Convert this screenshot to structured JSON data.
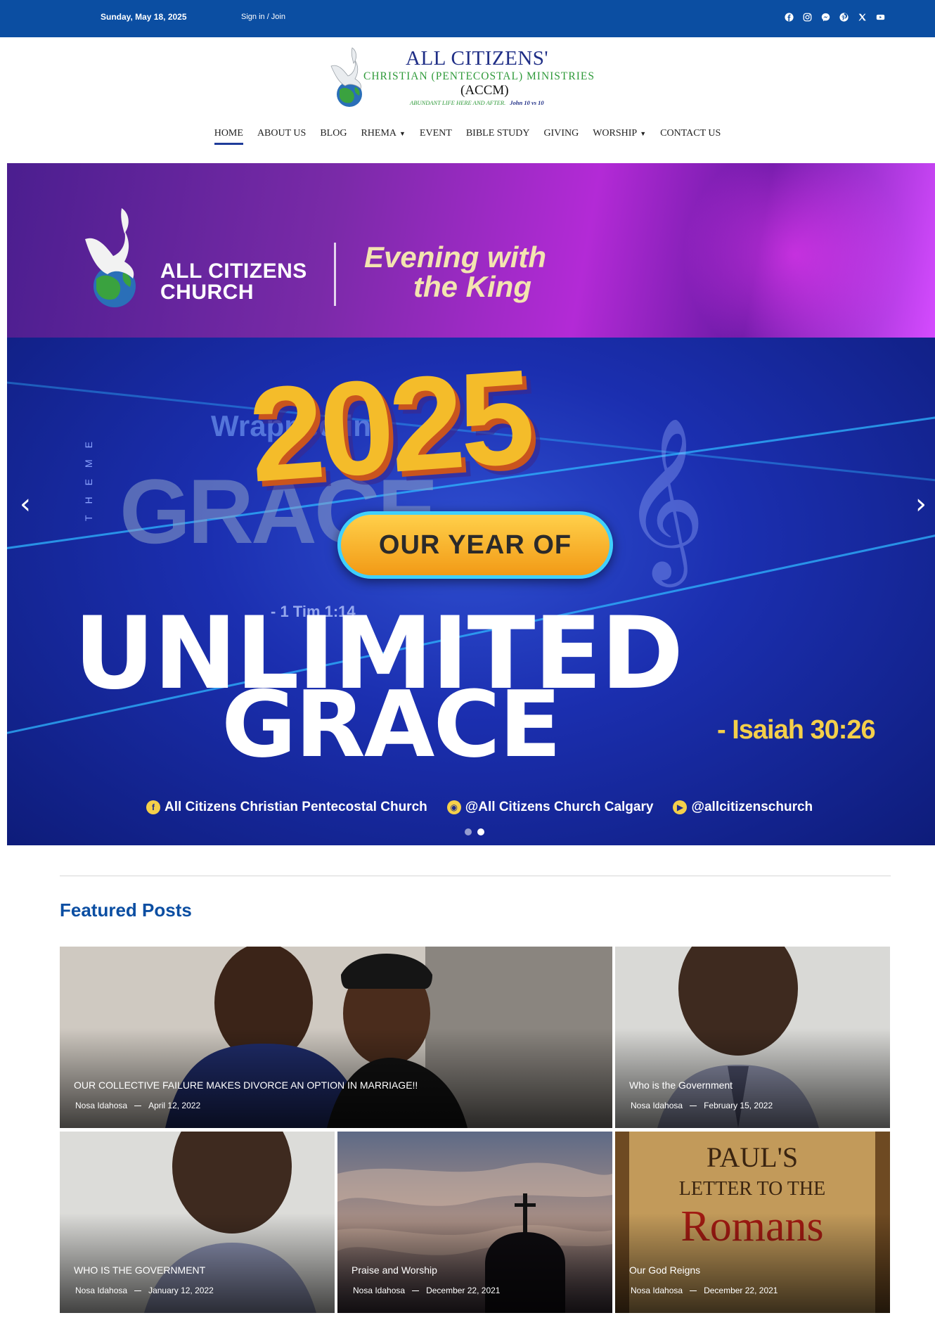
{
  "topbar": {
    "date": "Sunday, May 18, 2025",
    "signin": "Sign in / Join",
    "social": [
      "facebook-icon",
      "instagram-icon",
      "messenger-icon",
      "pinterest-icon",
      "x-icon",
      "youtube-icon"
    ]
  },
  "logo": {
    "line1": "ALL CITIZENS'",
    "line2": "CHRISTIAN (PENTECOSTAL) MINISTRIES",
    "line3": "(ACCM)",
    "tagline": "ABUNDANT LIFE HERE AND AFTER.",
    "verse": "John 10 vs 10"
  },
  "nav": [
    {
      "label": "HOME",
      "dropdown": false,
      "active": true
    },
    {
      "label": "ABOUT US",
      "dropdown": false
    },
    {
      "label": "BLOG",
      "dropdown": false
    },
    {
      "label": "RHEMA",
      "dropdown": true
    },
    {
      "label": "EVENT",
      "dropdown": false
    },
    {
      "label": "BIBLE STUDY",
      "dropdown": false
    },
    {
      "label": "GIVING",
      "dropdown": false
    },
    {
      "label": "WORSHIP",
      "dropdown": true
    },
    {
      "label": "CONTACT US",
      "dropdown": false
    }
  ],
  "hero": {
    "church_line1": "ALL CITIZENS",
    "church_line2": "CHURCH",
    "event_line1": "Evening with",
    "event_line2": "the King",
    "theme_label": "THEME",
    "wrapped": "Wrapped in",
    "ghost": "GRACE",
    "year": "2025",
    "pill": "OUR YEAR OF",
    "tim": "- 1 Tim 1:14",
    "headline1": "UNLIMITED",
    "headline2": "GRACE",
    "verse": "- Isaiah 30:26",
    "social_fb": "All Citizens Christian Pentecostal Church",
    "social_ig": "@All Citizens Church Calgary",
    "social_yt": "@allcitizenschurch",
    "slides_total": 2,
    "slide_active": 2
  },
  "featured": {
    "title": "Featured Posts",
    "posts": [
      {
        "title": "OUR COLLECTIVE FAILURE MAKES DIVORCE AN OPTION IN MARRIAGE!!",
        "author": "Nosa Idahosa",
        "date": "April 12, 2022"
      },
      {
        "title": "Who is the Government",
        "author": "Nosa Idahosa",
        "date": "February 15, 2022"
      },
      {
        "title": "WHO IS THE GOVERNMENT",
        "author": "Nosa Idahosa",
        "date": "January 12, 2022"
      },
      {
        "title": "Praise and Worship",
        "author": "Nosa Idahosa",
        "date": "December 22, 2021"
      },
      {
        "title": "Our God Reigns",
        "author": "Nosa Idahosa",
        "date": "December 22, 2021"
      }
    ],
    "romans_art": {
      "l1": "PAUL'S",
      "l2": "LETTER TO THE",
      "l3": "Romans"
    }
  }
}
